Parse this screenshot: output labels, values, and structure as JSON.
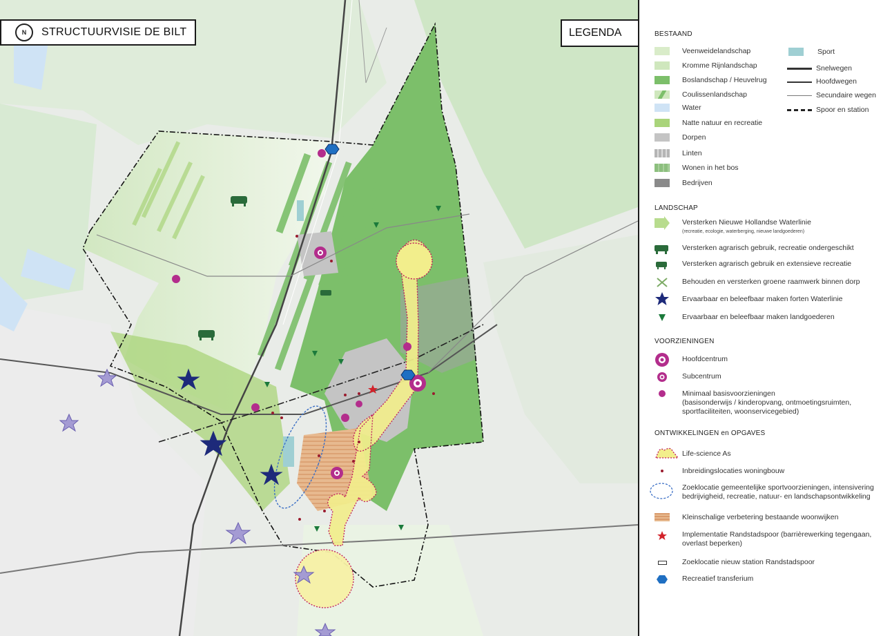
{
  "map": {
    "title": "STRUCTUURVISIE DE BILT",
    "north_symbol": "N",
    "legend_tab": "LEGENDA"
  },
  "legend": {
    "bestaand": {
      "title": "BESTAAND",
      "left_items": [
        {
          "label": "Veenweidelandschap",
          "color": "#d9ecc9"
        },
        {
          "label": "Kromme Rijnlandschap",
          "color": "#cfe7bd"
        },
        {
          "label": "Boslandschap / Heuvelrug",
          "color": "#7cbf6a"
        },
        {
          "label": "Coulissenlandschap",
          "color": "#b8dc8e"
        },
        {
          "label": "Water",
          "color": "#cfe3f5"
        },
        {
          "label": "Natte natuur en recreatie",
          "color": "#a9d47a"
        },
        {
          "label": "Dorpen",
          "color": "#c4c4c4"
        },
        {
          "label": "Linten",
          "color": "#b5b5b5"
        },
        {
          "label": "Wonen in het bos",
          "color": "#8cbf7e"
        },
        {
          "label": "Bedrijven",
          "color": "#8a8a8a"
        }
      ],
      "right_items": [
        {
          "label": "Sport",
          "color": "#9fcfd3"
        },
        {
          "label": "Snelwegen"
        },
        {
          "label": "Hoofdwegen"
        },
        {
          "label": "Secundaire wegen"
        },
        {
          "label": "Spoor en station"
        }
      ]
    },
    "landschap": {
      "title": "LANDSCHAP",
      "items": [
        {
          "label": "Versterken Nieuwe Hollandse Waterlinie",
          "sub": "(recreatie, ecologie, waterberging, nieuwe landgoederen)",
          "icon": "arrow-icon"
        },
        {
          "label": "Versterken agrarisch gebruik, recreatie ondergeschikt",
          "icon": "cow-1-icon"
        },
        {
          "label": "Versterken agrarisch gebruik en extensieve recreatie",
          "icon": "cow-2-icon"
        },
        {
          "label": "Behouden en versterken groene raamwerk binnen dorp",
          "icon": "green-cross-icon"
        },
        {
          "label": "Ervaarbaar en beleefbaar maken forten Waterlinie",
          "icon": "fort-star-icon"
        },
        {
          "label": "Ervaarbaar en beleefbaar maken landgoederen",
          "icon": "estate-triangle-icon"
        }
      ]
    },
    "voorzieningen": {
      "title": "VOORZIENINGEN",
      "items": [
        {
          "label": "Hoofdcentrum",
          "icon": "hoofdcentrum-icon"
        },
        {
          "label": "Subcentrum",
          "icon": "subcentrum-icon"
        },
        {
          "label": "Minimaal basisvoorzieningen",
          "line2": "(basisonderwijs / kinderopvang, ontmoetingsruimten,",
          "line3": "sportfaciliteiten, woonservicegebied)",
          "icon": "basis-dot-icon"
        }
      ]
    },
    "ontwikkelingen": {
      "title": "ONTWIKKELINGEN en OPGAVES",
      "items": [
        {
          "label": "Life-science As",
          "icon": "life-science-icon"
        },
        {
          "label": "Inbreidingslocaties woningbouw",
          "icon": "red-dot-icon"
        },
        {
          "label": "Zoeklocatie gemeentelijke sportvoorzieningen, intensivering",
          "line2": "bedrijvigheid, recreatie, natuur- en landschapsontwikkeling",
          "icon": "dashed-ellipse-icon"
        },
        {
          "label": "Kleinschalige verbetering bestaande woonwijken",
          "icon": "hatch-icon"
        },
        {
          "label": "Implementatie Randstadspoor (barrièrewerking tegengaan,",
          "line2": "overlast beperken)",
          "icon": "red-star-icon"
        },
        {
          "label": "Zoeklocatie nieuw station Randstadspoor",
          "icon": "station-rect-icon"
        },
        {
          "label": "Recreatief transferium",
          "icon": "hexagon-icon"
        }
      ]
    }
  }
}
